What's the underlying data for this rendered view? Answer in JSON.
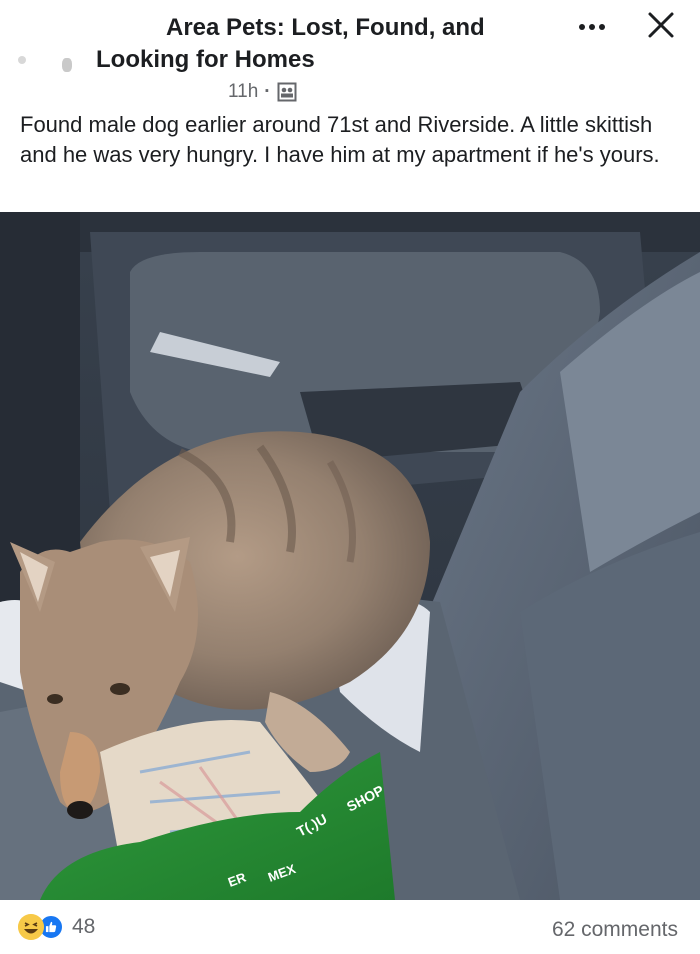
{
  "post": {
    "group_name_line1": "Area Pets: Lost, Found, and",
    "group_name_line2": "Looking for Homes",
    "time": "11h",
    "separator": "·",
    "audience_icon": "group-members-icon",
    "body": "Found male dog earlier around 71st and Riverside. A little skittish and he was very hungry. I have him at my apartment if he's yours."
  },
  "photo": {
    "bag_text_1": "SHOP",
    "bag_text_2": "T(.)U",
    "bag_text_3": "ER",
    "bag_text_4": "MEX"
  },
  "footer": {
    "reaction_icons": [
      "haha-icon",
      "like-icon"
    ],
    "reaction_count": "48",
    "comments": "62 comments"
  },
  "colors": {
    "text_primary": "#1c1e21",
    "text_secondary": "#65676b",
    "like_blue": "#1877f2",
    "haha_yellow": "#f7c948"
  }
}
